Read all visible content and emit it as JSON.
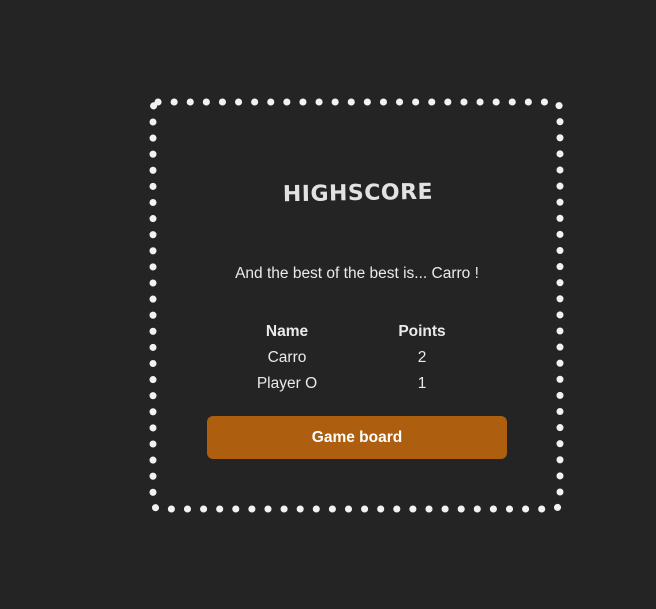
{
  "highscore": {
    "title": "HIGHSCORE",
    "winner_text": "And the best of the best is... Carro !",
    "table": {
      "headers": [
        "Name",
        "Points"
      ],
      "rows": [
        {
          "name": "Carro",
          "points": "2"
        },
        {
          "name": "Player O",
          "points": "1"
        }
      ]
    },
    "button_label": "Game board"
  },
  "colors": {
    "background": "#242424",
    "border_dots": "#f2f2f2",
    "button": "#ad5e0e"
  }
}
